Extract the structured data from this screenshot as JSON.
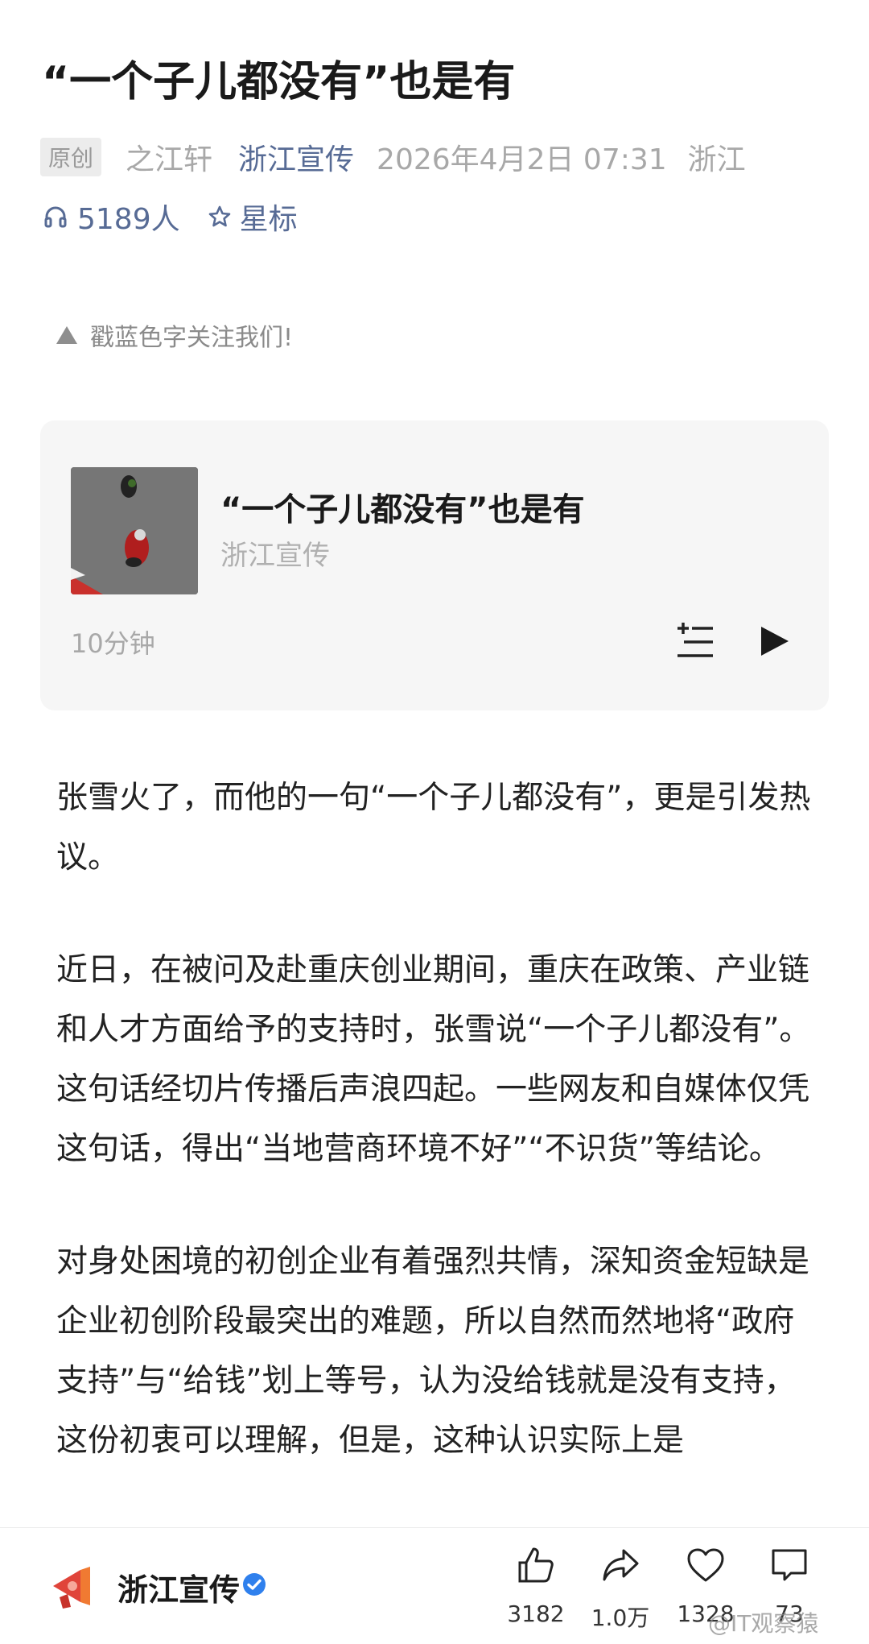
{
  "article": {
    "title": "“一个子儿都没有”也是有",
    "original_badge": "原创",
    "author": "之江轩",
    "account": "浙江宣传",
    "date": "2026年4月2日 07:31",
    "location": "浙江",
    "listen_count": "5189人",
    "star_label": "星标"
  },
  "notice": {
    "text": "戳蓝色字关注我们!"
  },
  "audio": {
    "title": "“一个子儿都没有”也是有",
    "source": "浙江宣传",
    "duration": "10分钟",
    "playlist_icon": "playlist-icon",
    "play_icon": "play-icon"
  },
  "body": {
    "paragraphs": [
      "张雪火了，而他的一句“一个子儿都没有”，更是引发热议。",
      "近日，在被问及赴重庆创业期间，重庆在政策、产业链和人才方面给予的支持时，张雪说“一个子儿都没有”。这句话经切片传播后声浪四起。一些网友和自媒体仅凭这句话，得出“当地营商环境不好”“不识货”等结论。",
      "对身处困境的初创企业有着强烈共情，深知资金短缺是企业初创阶段最突出的难题，所以自然而然地将“政府支持”与“给钱”划上等号，认为没给钱就是没有支持，这份初衷可以理解，但是，这种认识实际上是"
    ]
  },
  "bottom_bar": {
    "account_name": "浙江宣传",
    "likes": "3182",
    "shares": "1.0万",
    "favorites": "1328",
    "comments": "73"
  },
  "watermark": {
    "text": "@IT观察猿"
  },
  "colors": {
    "link_blue": "#576b95",
    "verified_blue": "#2f80ed",
    "logo_red": "#e0443a"
  }
}
